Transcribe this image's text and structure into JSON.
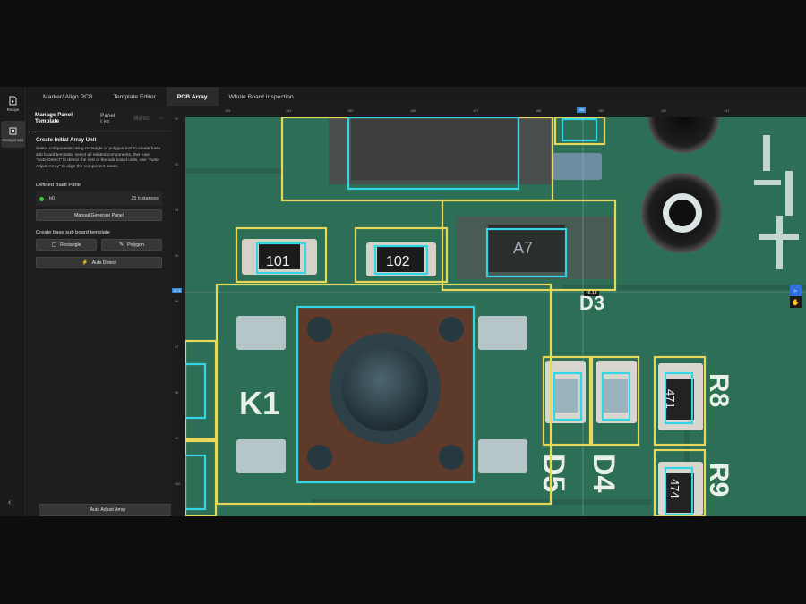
{
  "rail": {
    "items": [
      {
        "label": "Recipe",
        "icon": "recipe-icon"
      },
      {
        "label": "Component",
        "icon": "component-icon"
      }
    ]
  },
  "tabs": [
    "Marker/ Align PCB",
    "Template Editor",
    "PCB Array",
    "Whole Board Inspection"
  ],
  "active_tab": "PCB Array",
  "panel": {
    "tabs": [
      "Manage Panel Template",
      "Panel List",
      "Memo"
    ],
    "more": "⋯",
    "title": "Create Initial Array Unit",
    "description": "Select components using rectangle or polygon tool to create base sub board template, select all related components, then use \"Auto-Detect\" to detect the rest of the sub board units, use \"Auto-Adjust Array\" to align the component boxes.",
    "defined_label": "Defined Base Panel",
    "base": {
      "name": "b0",
      "instances": "25 Instances",
      "status_color": "#3cc83c"
    },
    "manual_btn": "Manual Generate Panel",
    "create_label": "Create base sub board template",
    "rect_btn": "Rectangle",
    "poly_btn": "Polygon",
    "auto_detect_btn": "Auto Detect",
    "auto_adjust_btn": "Auto Adjust Array"
  },
  "canvas": {
    "ruler_x": [
      "183",
      "184",
      "185",
      "186",
      "187",
      "188",
      "189",
      "190",
      "191"
    ],
    "ruler_y": [
      "92",
      "93",
      "94",
      "95",
      "96",
      "97",
      "98",
      "99",
      "100"
    ],
    "cursor_x": "190",
    "cursor_y": "97.3",
    "cursor_readout": "46.18",
    "silkscreen": [
      "101",
      "102",
      "A7",
      "K1",
      "D5",
      "D4",
      "R8",
      "R9",
      "D3",
      "471",
      "474"
    ],
    "colors": {
      "board": "#2d6e56",
      "panel_box": "#e6d85a",
      "component_box": "#33d6e6",
      "tool_active": "#2f6fe0"
    }
  }
}
